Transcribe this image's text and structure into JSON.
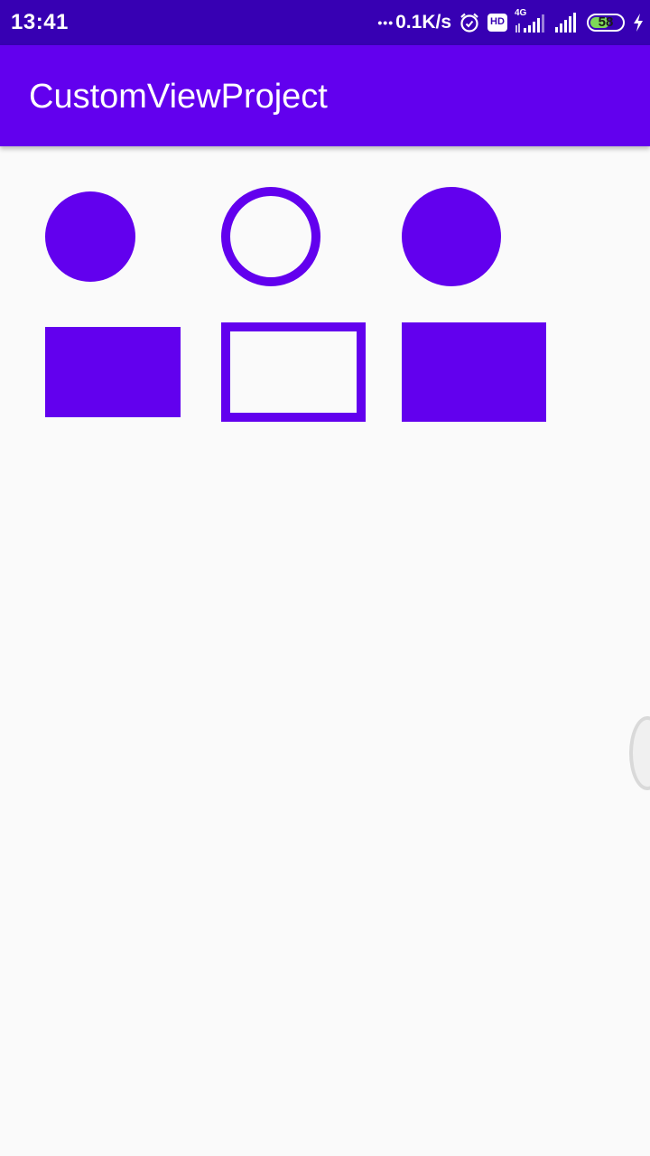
{
  "status_bar": {
    "time": "13:41",
    "dots": "•••",
    "network_speed": "0.1K/s",
    "hd_label": "HD",
    "network_type": "4G",
    "battery_level": "58",
    "icons": [
      "alarm-icon",
      "hd-icon",
      "signal-4g-icon",
      "signal-icon",
      "battery-icon",
      "charging-icon"
    ]
  },
  "app_bar": {
    "title": "CustomViewProject"
  },
  "shapes": [
    {
      "name": "filled-circle-small",
      "kind": "circle",
      "style": "filled"
    },
    {
      "name": "outline-circle",
      "kind": "circle",
      "style": "stroke"
    },
    {
      "name": "filled-circle-large",
      "kind": "circle",
      "style": "filled"
    },
    {
      "name": "filled-rect-small",
      "kind": "rectangle",
      "style": "filled"
    },
    {
      "name": "outline-rect",
      "kind": "rectangle",
      "style": "stroke"
    },
    {
      "name": "filled-rect-large",
      "kind": "rectangle",
      "style": "filled"
    }
  ],
  "colors": {
    "status_bar": "#3700b3",
    "primary": "#6200ee",
    "background": "#fafafa",
    "battery_fill": "#7ed957"
  }
}
